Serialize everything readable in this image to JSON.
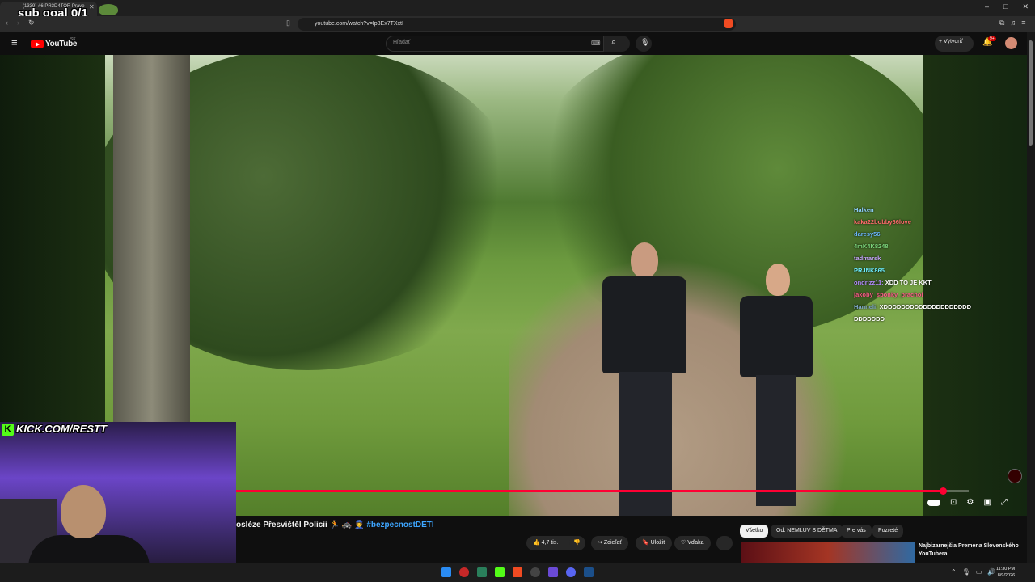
{
  "browser": {
    "tab_title": "(1339) #6 PR3D4TOR Prave",
    "url": "youtube.com/watch?v=Ip8Ex7TXxtI"
  },
  "overlay": {
    "sub_goal": "sub goal 0/1",
    "kick_text": "KICK.COM/RESTT",
    "kick_k": "K"
  },
  "youtube": {
    "logo_text": "YouTube",
    "region": "SK",
    "search_placeholder": "Hľadať",
    "create_label": "Vytvoriť",
    "notifications_count": "9+"
  },
  "chat": [
    {
      "user": "Halken",
      "message": ""
    },
    {
      "user": "kaka22bobby66love",
      "message": ""
    },
    {
      "user": "daresy56",
      "message": ""
    },
    {
      "user": "4mK4K8248",
      "message": ""
    },
    {
      "user": "tadmarsk",
      "message": ""
    },
    {
      "user": "PRJNK865",
      "message": ""
    },
    {
      "user": "ondrizz11:",
      "message": "XDD TO JE KKT"
    },
    {
      "user": "jakoby_sponky_prachol",
      "message": ""
    },
    {
      "user": "Hanneli:",
      "message": "XDDDDDDDDDDDDDDDDDDDD DDDDDDD"
    }
  ],
  "player": {
    "progress_fraction": 0.97
  },
  "video": {
    "title": "nakonec se ale rozhodla vyslovit a pak se ale posléze Přesvištěl Policii 🏃 🚓 👮",
    "title_visible": "osléze Přesvištěl Policii",
    "hashtag": "#bezpecnostDETI",
    "likes": "4,7 tis.",
    "share_label": "Zdieľať",
    "save_label": "Uložiť",
    "thanks_label": "Vďaka",
    "more_label": "⋯"
  },
  "chips": [
    "Všetko",
    "Od: NEMLUV S DĚTMA",
    "Pre vás",
    "Pozreté"
  ],
  "recommendation": {
    "title": "Najbizarnejšia Premena Slovenského YouTubera"
  },
  "taskbar": {
    "time": "11:30 PM",
    "date": "8/9/2026"
  },
  "colors": {
    "youtube_red": "#ff0000",
    "progress_red": "#ff0033",
    "kick_green": "#53fc18",
    "link_blue": "#3ea6ff"
  }
}
